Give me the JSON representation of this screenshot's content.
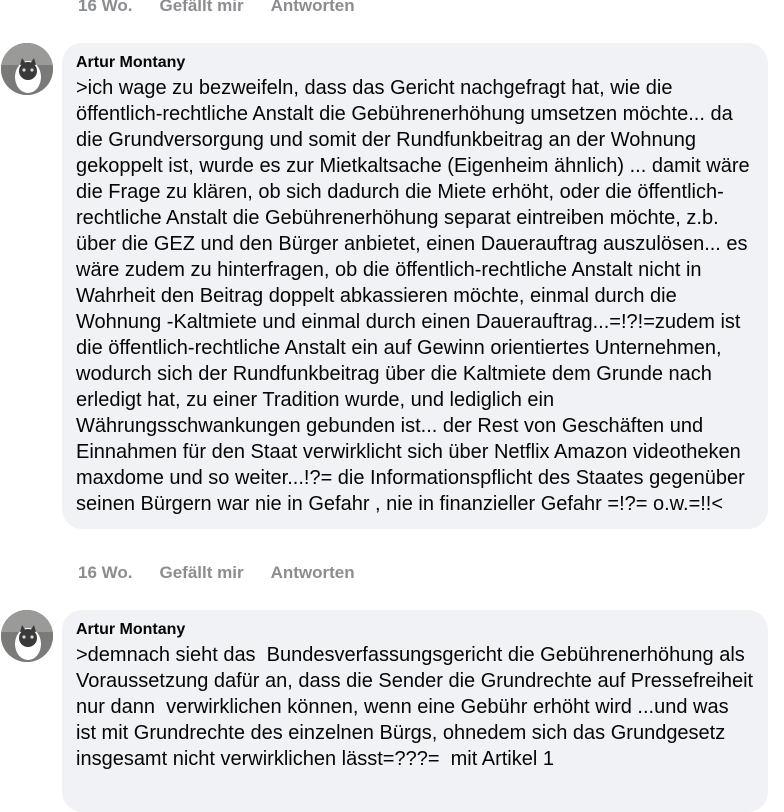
{
  "top_actions": {
    "time": "16 Wo.",
    "like": "Gefällt mir",
    "reply": "Antworten"
  },
  "comments": [
    {
      "author": "Artur Montany",
      "text": ">ich wage zu bezweifeln, dass das Gericht nachgefragt hat, wie die öffentlich-rechtliche Anstalt die Gebührenerhöhung umsetzen möchte... da die Grundversorgung und somit der Rundfunkbeitrag an der Wohnung gekoppelt ist, wurde es zur Mietkaltsache (Eigenheim ähnlich) ... damit wäre die Frage zu klären, ob sich dadurch die Miete erhöht, oder die öffentlich-rechtliche Anstalt die Gebührenerhöhung separat eintreiben möchte, z.b. über die GEZ und den Bürger anbietet, einen Dauerauftrag auszulösen... es wäre zudem zu hinterfragen, ob die öffentlich-rechtliche Anstalt nicht in Wahrheit den Beitrag doppelt abkassieren möchte, einmal durch die Wohnung -Kaltmiete und einmal durch einen Dauerauftrag...=!?!=zudem ist die öffentlich-rechtliche Anstalt ein auf Gewinn orientiertes Unternehmen, wodurch sich der Rundfunkbeitrag über die Kaltmiete dem Grunde nach erledigt hat, zu einer Tradition wurde, und lediglich ein Währungsschwankungen gebunden ist... der Rest von Geschäften und Einnahmen für den Staat verwirklicht sich über Netflix Amazon videotheken maxdome und so weiter...!?= die Informationspflicht des Staates gegenüber seinen Bürgern war nie in Gefahr , nie in finanzieller Gefahr =!?= o.w.=!!<",
      "time": "16 Wo.",
      "like": "Gefällt mir",
      "reply": "Antworten"
    },
    {
      "author": "Artur Montany",
      "text": ">demnach sieht das  Bundesverfassungsgericht die Gebührenerhöhung als Voraussetzung dafür an, dass die Sender die Grundrechte auf Pressefreiheit nur dann  verwirklichen können, wenn eine Gebühr erhöht wird ...und was ist mit Grundrechte des einzelnen Bürgs, ohnedem sich das Grundgesetz insgesamt nicht verwirklichen lässt=???=  mit Artikel 1"
    }
  ]
}
